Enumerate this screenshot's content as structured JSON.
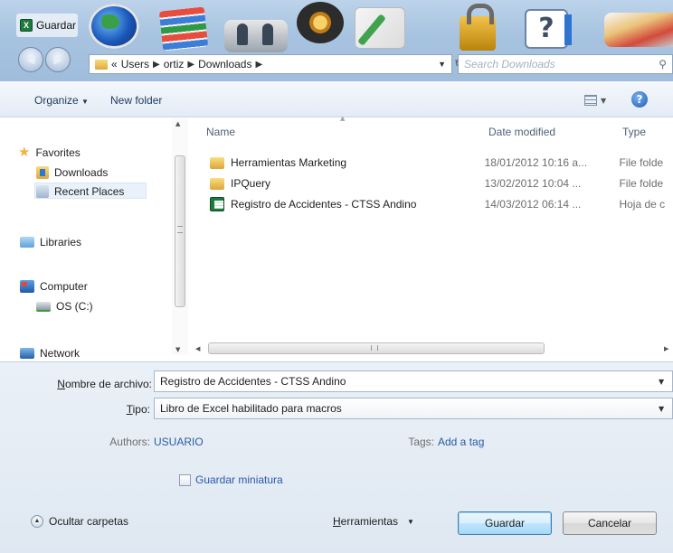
{
  "window": {
    "title": "Guardar c"
  },
  "address": {
    "crumbs": [
      "«",
      "Users",
      "ortiz",
      "Downloads"
    ],
    "search_placeholder": "Search Downloads"
  },
  "toolbar": {
    "organize_label": "Organize",
    "new_folder_label": "New folder"
  },
  "nav": {
    "favorites": "Favorites",
    "downloads": "Downloads",
    "recent_places": "Recent Places",
    "libraries": "Libraries",
    "computer": "Computer",
    "os_drive": "OS (C:)",
    "network": "Network"
  },
  "columns": {
    "name": "Name",
    "date": "Date modified",
    "type": "Type"
  },
  "files": [
    {
      "name": "Herramientas Marketing",
      "date": "18/01/2012 10:16 a...",
      "type": "File folde",
      "icon": "folder-icon"
    },
    {
      "name": "IPQuery",
      "date": "13/02/2012 10:04 ...",
      "type": "File folde",
      "icon": "folder-icon"
    },
    {
      "name": "Registro de Accidentes - CTSS Andino",
      "date": "14/03/2012 06:14 ...",
      "type": "Hoja de c",
      "icon": "excel-file-icon"
    }
  ],
  "form": {
    "filename_label": "Nombre de archivo:",
    "filename_value": "Registro de Accidentes - CTSS Andino",
    "filetype_label": "Tipo:",
    "filetype_value": "Libro de Excel habilitado para macros",
    "authors_label": "Authors:",
    "authors_value": "USUARIO",
    "tags_label": "Tags:",
    "tags_value": "Add a tag",
    "thumbnail_label": "Guardar miniatura"
  },
  "footer": {
    "hide_folders_label": "Ocultar carpetas",
    "tools_label": "Herramientas",
    "save_label": "Guardar",
    "cancel_label": "Cancelar"
  }
}
